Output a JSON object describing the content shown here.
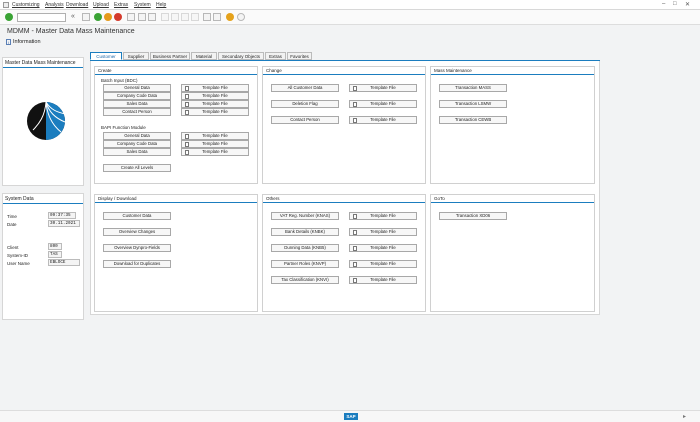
{
  "menubar": {
    "items": [
      "Customizing",
      "Analysis",
      "Download",
      "Upload",
      "Extras",
      "System",
      "Help"
    ]
  },
  "header": {
    "title": "MDMM - Master Data Mass Maintenance",
    "info_label": "Information"
  },
  "sidebar": {
    "top_title": "Master Data Mass Maintenance",
    "system_title": "System Data",
    "rows": [
      {
        "label": "Time",
        "value": "09:37:35"
      },
      {
        "label": "Date",
        "value": "30.11.2021"
      },
      {
        "label": "Client",
        "value": "800"
      },
      {
        "label": "System-ID",
        "value": "TAS"
      },
      {
        "label": "User Name",
        "value": "EBLOCE"
      }
    ]
  },
  "tabs": [
    "Customer",
    "Supplier",
    "Business Partner",
    "Material",
    "Secondary Objects",
    "Extras",
    "Favorites"
  ],
  "active_tab": "Customer",
  "create": {
    "title": "Create",
    "batch_title": "Batch Input (BDC)",
    "batch_buttons": [
      "General Data",
      "Company Code Data",
      "Sales Data",
      "Contact Person"
    ],
    "bapi_title": "BAPI Function Module",
    "bapi_buttons": [
      "General Data",
      "Company Code Data",
      "Sales Data"
    ],
    "template_label": "Template File",
    "create_all": "Create All Levels"
  },
  "change": {
    "title": "Change",
    "buttons": [
      "All Customer Data",
      "Deletion Flag",
      "Contact Person"
    ],
    "template_label": "Template File"
  },
  "mass": {
    "title": "Mass Maintenance",
    "buttons": [
      "Transaction MASS",
      "Transaction LSMW",
      "Transaction CEWB"
    ]
  },
  "display": {
    "title": "Display / Download",
    "buttons": [
      "Customer Data",
      "Overview Changes",
      "Overview Dynpro-Fields",
      "Download for Duplicates"
    ]
  },
  "others": {
    "title": "Others",
    "buttons": [
      "VAT Reg. Number (KNAS)",
      "Bank Details (KNBK)",
      "Dunning Data (KNB5)",
      "Partner Roles (KNVP)",
      "Tax Classification (KNVI)"
    ],
    "template_label": "Template File"
  },
  "goto": {
    "title": "GoTo",
    "buttons": [
      "Transaction XD06"
    ]
  },
  "statusbar": {
    "logo": "SAP"
  },
  "colors": {
    "accent": "#1b7dbf",
    "ok_green": "#3aa335",
    "exit_orange": "#e59a1c",
    "cancel_red": "#d43a2c"
  }
}
